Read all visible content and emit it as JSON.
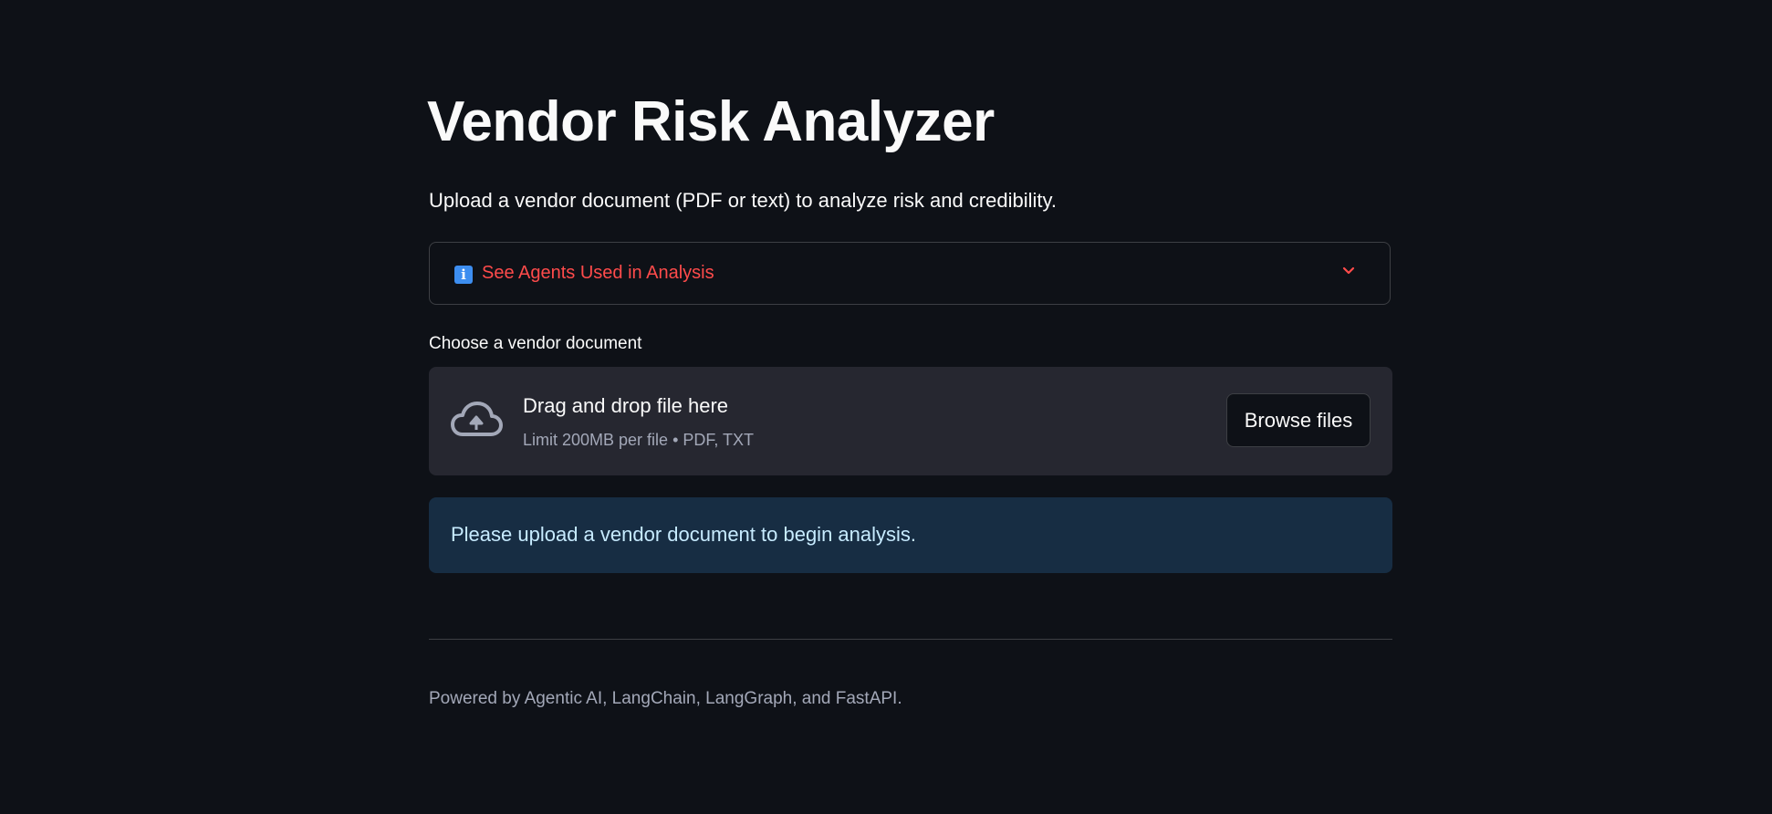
{
  "page": {
    "title": "Vendor Risk Analyzer",
    "subtitle": "Upload a vendor document (PDF or text) to analyze risk and credibility."
  },
  "expander": {
    "icon": "info-icon",
    "icon_glyph": "i",
    "label": "See Agents Used in Analysis",
    "expanded": false,
    "chevron_icon": "chevron-down-icon"
  },
  "uploader": {
    "label": "Choose a vendor document",
    "icon": "cloud-upload-icon",
    "drop_title": "Drag and drop file here",
    "drop_hint": "Limit 200MB per file • PDF, TXT",
    "browse_label": "Browse files"
  },
  "alert": {
    "type": "info",
    "text": "Please upload a vendor document to begin analysis."
  },
  "footer": {
    "text": "Powered by Agentic AI, LangChain, LangGraph, and FastAPI."
  },
  "colors": {
    "background": "#0e1117",
    "accent": "#ff4b4b",
    "dropzone": "#262730",
    "info_bg": "#172d43",
    "info_text": "#c7ebff"
  }
}
